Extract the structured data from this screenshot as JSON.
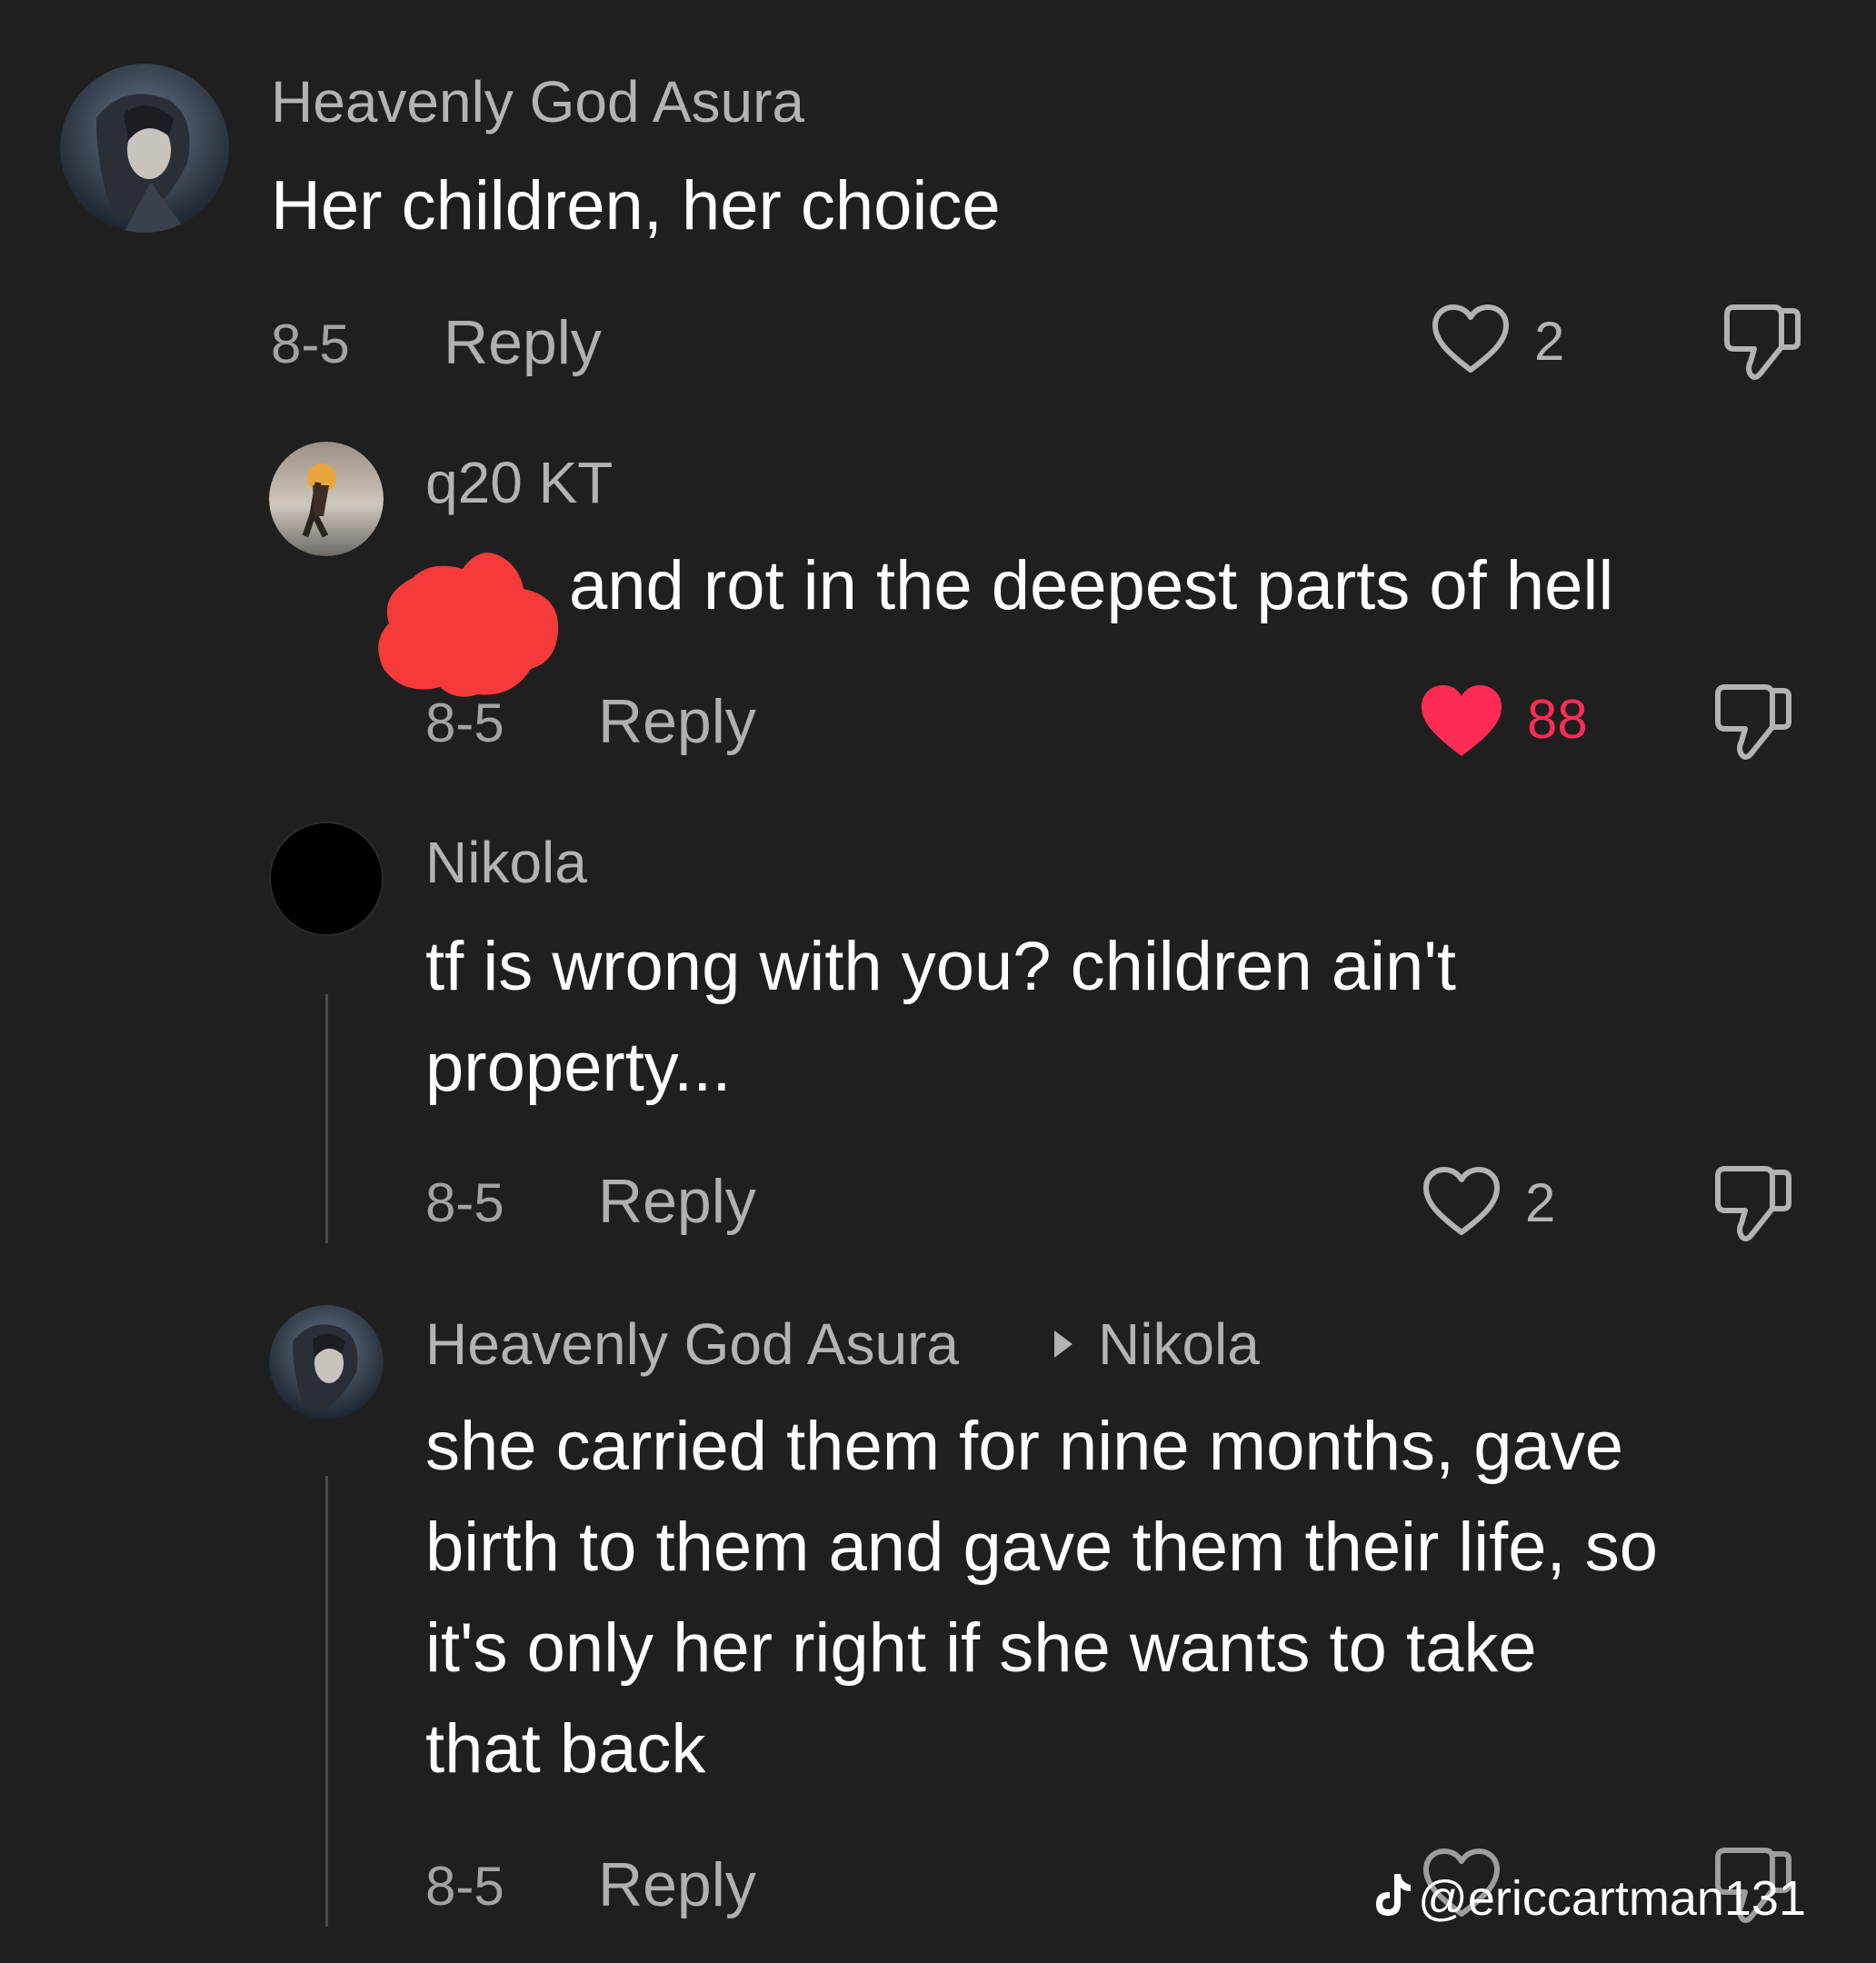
{
  "accent_color": "#fe2c55",
  "comments": [
    {
      "username": "Heavenly God Asura",
      "text": "Her children, her choice",
      "date": "8-5",
      "reply_label": "Reply",
      "likes": "2",
      "liked": false
    },
    {
      "username": "q20 KT",
      "text": "and rot in the deepest parts of hell",
      "date": "8-5",
      "reply_label": "Reply",
      "likes": "88",
      "liked": true
    },
    {
      "username": "Nikola",
      "text_lines": [
        "tf is wrong with you? children ain't",
        "property..."
      ],
      "date": "8-5",
      "reply_label": "Reply",
      "likes": "2",
      "liked": false
    },
    {
      "username": "Heavenly God Asura",
      "reply_to": "Nikola",
      "text_lines": [
        "she carried them for nine months, gave",
        "birth to them and gave them their life, so",
        "it's only her right if she wants to take",
        "that back"
      ],
      "date": "8-5",
      "reply_label": "Reply"
    }
  ],
  "watermark": {
    "icon": "tiktok-logo-icon",
    "handle": "@ericcartman131"
  }
}
